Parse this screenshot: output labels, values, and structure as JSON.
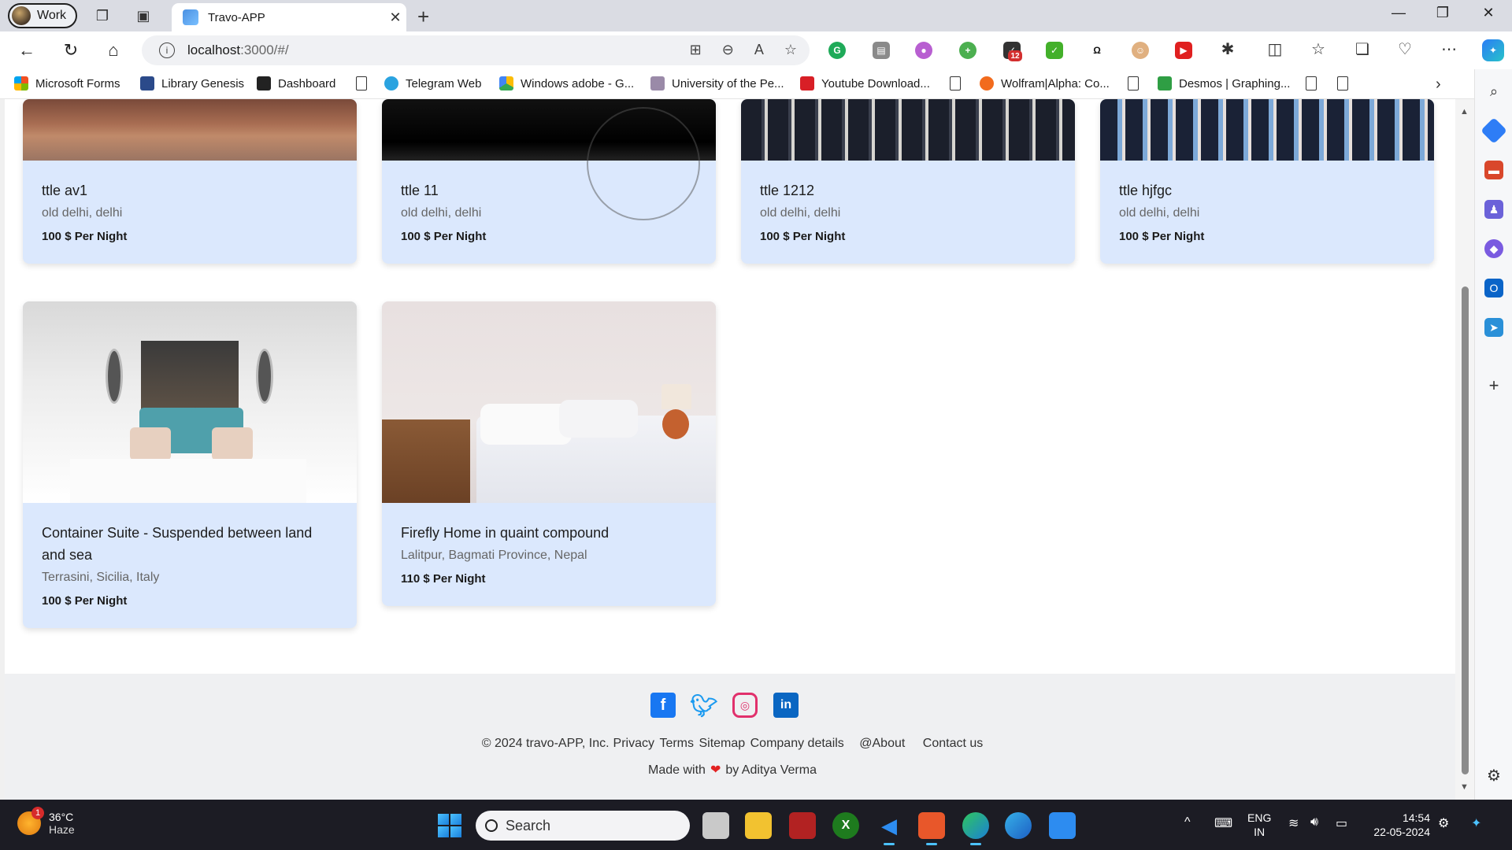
{
  "browser": {
    "profile_label": "Work",
    "tab_title": "Travo-APP",
    "url_host": "localhost",
    "url_rest": ":3000/#/",
    "ext_badge_count": "12"
  },
  "bookmarks": [
    {
      "label": "Microsoft Forms"
    },
    {
      "label": "Library Genesis"
    },
    {
      "label": "Dashboard"
    },
    {
      "label": ""
    },
    {
      "label": "Telegram Web"
    },
    {
      "label": "Windows adobe - G..."
    },
    {
      "label": "University of the Pe..."
    },
    {
      "label": "Youtube Download..."
    },
    {
      "label": ""
    },
    {
      "label": "Wolfram|Alpha: Co..."
    },
    {
      "label": ""
    },
    {
      "label": "Desmos | Graphing..."
    }
  ],
  "listings_top": [
    {
      "title": "ttle av1",
      "location": "old delhi, delhi",
      "price": "100 $ Per Night"
    },
    {
      "title": "ttle 11",
      "location": "old delhi, delhi",
      "price": "100 $ Per Night"
    },
    {
      "title": "ttle 1212",
      "location": "old delhi, delhi",
      "price": "100 $ Per Night"
    },
    {
      "title": "ttle hjfgc",
      "location": "old delhi, delhi",
      "price": "100 $ Per Night"
    }
  ],
  "listings_bottom": [
    {
      "title": "Container Suite - Suspended between land and sea",
      "location": "Terrasini, Sicilia, Italy",
      "price": "100 $ Per Night"
    },
    {
      "title": "Firefly Home in quaint compound",
      "location": "Lalitpur, Bagmati Province, Nepal",
      "price": "110 $ Per Night"
    }
  ],
  "footer": {
    "socials": [
      "facebook-icon",
      "twitter-icon",
      "instagram-icon",
      "linkedin-icon"
    ],
    "copyright": "© 2024 travo-APP, Inc.",
    "links": [
      "Privacy",
      "Terms",
      "Sitemap",
      "Company details"
    ],
    "about": "@About",
    "contact": "Contact us",
    "made_prefix": "Made with",
    "made_suffix": "by Aditya Verma"
  },
  "taskbar": {
    "weather_badge": "1",
    "temp": "36°C",
    "condition": "Haze",
    "search_placeholder": "Search",
    "lang_line1": "ENG",
    "lang_line2": "IN",
    "time": "14:54",
    "date": "22-05-2024"
  },
  "colors": {
    "card_bg": "#dbe8fd",
    "footer_bg": "#eff0f2",
    "facebook": "#1877f2",
    "twitter": "#1d9bf0",
    "instagram": "#e1306c",
    "linkedin": "#0a66c2",
    "heart": "#e22222"
  }
}
